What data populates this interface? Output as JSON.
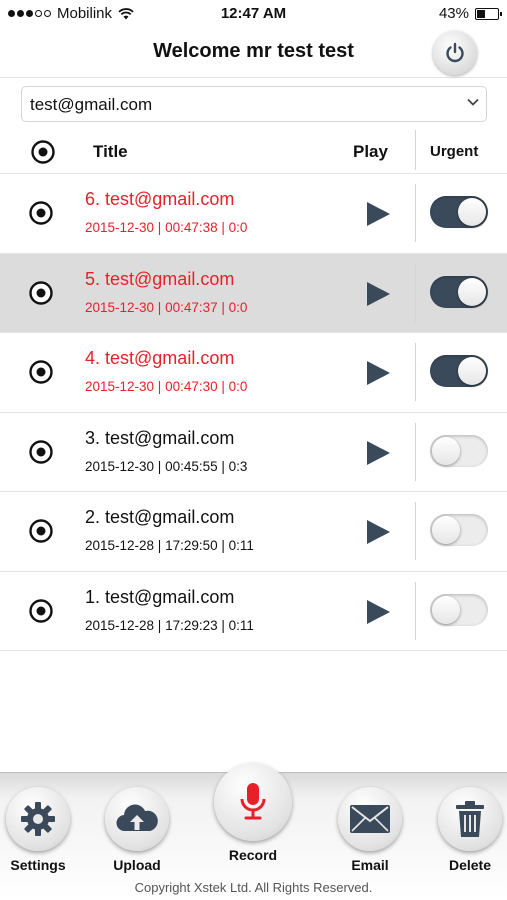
{
  "status_bar": {
    "carrier": "Mobilink",
    "time": "12:47 AM",
    "battery": "43%",
    "battery_level": 0.43
  },
  "header": {
    "title": "Welcome mr test test",
    "power_icon": "power-icon"
  },
  "email_select": {
    "value": "test@gmail.com"
  },
  "columns": {
    "title": "Title",
    "play": "Play",
    "urgent": "Urgent"
  },
  "colors": {
    "urgent_text": "#e8202a",
    "accent_dark": "#3b4a5a",
    "record_red": "#e8202a"
  },
  "recordings": [
    {
      "title": "6. test@gmail.com",
      "meta": "2015-12-30 | 00:47:38 | 0:0",
      "urgent": true,
      "selected": false
    },
    {
      "title": "5. test@gmail.com",
      "meta": "2015-12-30 | 00:47:37 | 0:0",
      "urgent": true,
      "selected": true
    },
    {
      "title": "4. test@gmail.com",
      "meta": "2015-12-30 | 00:47:30 | 0:0",
      "urgent": true,
      "selected": false
    },
    {
      "title": "3. test@gmail.com",
      "meta": "2015-12-30 | 00:45:55 | 0:3",
      "urgent": false,
      "selected": false
    },
    {
      "title": "2. test@gmail.com",
      "meta": "2015-12-28 | 17:29:50 | 0:11",
      "urgent": false,
      "selected": false
    },
    {
      "title": "1. test@gmail.com",
      "meta": "2015-12-28 | 17:29:23 | 0:11",
      "urgent": false,
      "selected": false
    }
  ],
  "tabs": {
    "settings": "Settings",
    "upload": "Upload",
    "record": "Record",
    "email": "Email",
    "delete": "Delete"
  },
  "footer": {
    "copyright": "Copyright Xstek Ltd. All Rights Reserved."
  }
}
